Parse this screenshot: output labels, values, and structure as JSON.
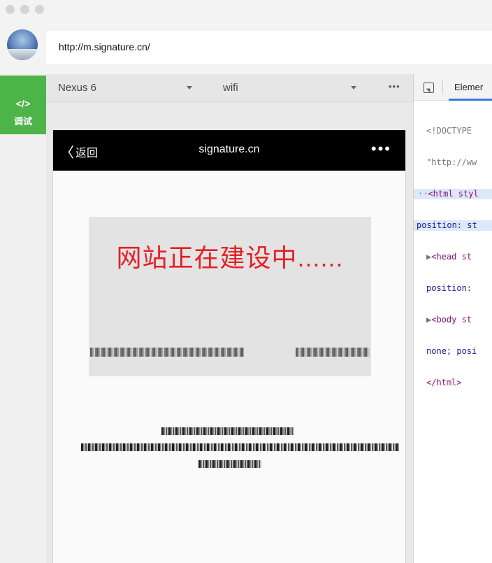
{
  "browser": {
    "url": "http://m.signature.cn/"
  },
  "sidebar": {
    "debug_icon": "</>",
    "debug_label": "调试"
  },
  "device_toolbar": {
    "device": "Nexus 6",
    "network": "wifi",
    "more": "•••"
  },
  "phone": {
    "nav": {
      "back_chevron": "〈",
      "back_label": "返回",
      "title": "signature.cn",
      "more": "•••"
    },
    "banner": {
      "title": "网站正在建设中......"
    }
  },
  "devtools": {
    "tab_label": "Elemer",
    "code_lines": [
      "<!DOCTYPE",
      "\"http://ww",
      "<html styl",
      "position: st",
      "<head st",
      "position:",
      "<body st",
      "none; posi",
      "</html>"
    ]
  },
  "icons": {
    "inspect": "inspect-element-icon",
    "chevron": "chevron-left-icon"
  },
  "colors": {
    "debug_green": "#4cb448",
    "banner_red": "#e81e25",
    "tab_blue": "#3879d9"
  }
}
